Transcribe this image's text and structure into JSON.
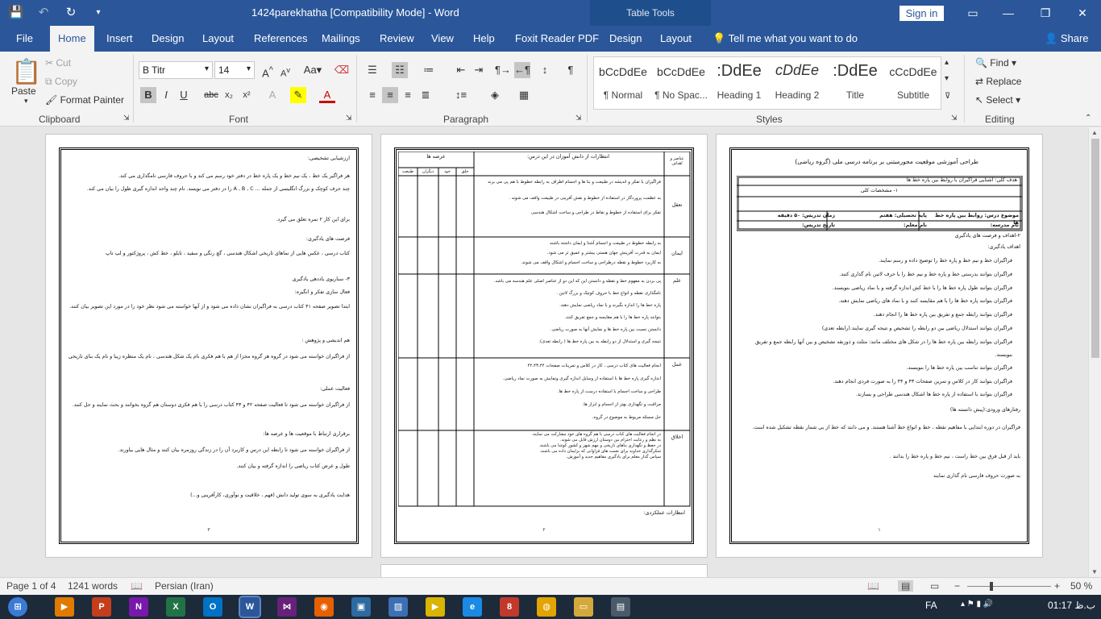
{
  "window": {
    "title": "1424parekhatha [Compatibility Mode]  -  Word",
    "context_tab": "Table Tools",
    "signin": "Sign in",
    "controls": {
      "minimize": "—",
      "restore": "❐",
      "close": "✕"
    }
  },
  "tabs": [
    "File",
    "Home",
    "Insert",
    "Design",
    "Layout",
    "References",
    "Mailings",
    "Review",
    "View",
    "Help",
    "Foxit Reader PDF",
    "Design",
    "Layout"
  ],
  "active_tab": "Home",
  "tellme": "Tell me what you want to do",
  "share": "Share",
  "ribbon": {
    "clipboard": {
      "label": "Clipboard",
      "paste": "Paste",
      "cut": "Cut",
      "copy": "Copy",
      "format_painter": "Format Painter"
    },
    "font": {
      "label": "Font",
      "name": "B Titr",
      "size": "14"
    },
    "paragraph": {
      "label": "Paragraph"
    },
    "styles": {
      "label": "Styles",
      "items": [
        {
          "preview": "bCcDdEe",
          "name": "¶ Normal"
        },
        {
          "preview": "bCcDdEe",
          "name": "¶ No Spac..."
        },
        {
          "preview": ":DdEe",
          "name": "Heading 1"
        },
        {
          "preview": "cDdEe",
          "name": "Heading 2"
        },
        {
          "preview": ":DdEe",
          "name": "Title"
        },
        {
          "preview": "cCcDdEe",
          "name": "Subtitle"
        }
      ]
    },
    "editing": {
      "label": "Editing",
      "find": "Find",
      "replace": "Replace",
      "select": "Select"
    }
  },
  "pages": {
    "page1": {
      "title": "طراحی آموزشی موقعیت محورمبتنی بر برنامه درسی ملی (گروه ریاضی)",
      "goal": "هدف کلی: آشنایی فراگیران با روابط بین پاره خط ها",
      "section1": "۱- مشخصات کلی",
      "topic": "موضوع درس: روابط بین پاره خط ها",
      "grade": "پایه تحصیلی: هفتم",
      "time": "زمان تدریس: ۵۰ دقیقه",
      "school": "نام مدرسه:",
      "teacher": "نام معلم:",
      "date": "تاریخ تدریس:",
      "goals_heading": "۲-اهداف و فرصت های یادگیری",
      "learning_goals": "اهداف یادگیری:",
      "bullets": [
        "فراگیران خط و نیم خط و پاره خط را توضیح داده و رسم نمایند.",
        "فراگیران بتوانند بدرستی خط و پاره خط و نیم خط را با حرف لاتین نام گذاری کنند.",
        "فراگیران بتوانند طول پاره خط ها را با خط کش اندازه گرفته و با نماد ریاضی بنویسند.",
        "فراگیران بتوانند پاره خط ها را با هم مقایسه کنند و با نماد های ریاضی نمایش دهند.",
        "فراگیران بتوانند رابطه جمع و تفریق بین پاره خط ها را انجام دهند.",
        "فراگیران بتوانند استدلال ریاضی بین دو رابطه را تشخیص و نتیجه گیری نمایند.(رابطه تعدی)",
        "فراگیران بتوانند رابطه بین پاره خط ها را در شکل های مختلف مانند: مثلث و ذوزنقه تشخیص و بین آنها رابطه جمع و تفریق بنویسند.",
        "فراگیران بتوانند تناسب بین پاره خط ها را بنویسند.",
        "فراگیران بتوانند کار در کلاس و تمرین صفحات ۴۳ و ۴۴ را به صورت فردی انجام دهند.",
        "فراگیران بتوانند با استفاده از پاره خط ها اشکال هندسی طراحی و بسازند."
      ],
      "entry": "رفتارهای ورودی:(پیش دانسته ها)",
      "entry_text": "فراگیران در دوره ابتدایی با مفاهیم نقطه ، خط و انواع خط آشنا هستند. و می دانند که خط از بی شمار نقطه تشکیل شده است.",
      "entry_text2": "باید از قبل فرق بین خط راست ، نیم خط و پاره خط را بدانند .",
      "entry_text3": "به صورت حروف فارسی نام گذاری نمایند",
      "page_number": "۱"
    },
    "page2": {
      "col_areas": "عرصه ها",
      "col_expectations": "انتظارات از دانش آموزان در این درس:",
      "col_elements": "عناصر و اهداف",
      "sub_cols": [
        "خلق",
        "خود",
        "دیگران",
        "طبیعت"
      ],
      "rows": [
        {
          "label": "تعقل",
          "lines": [
            "فراگیران با تفکر و اندیشه در طبیعت و بنا ها و اجسام اطراف به رابطه خطوط با هم پی می برند",
            "به عظمت پروردگار در استفاده از خطوط و نقش آفرینی در طبیعت واقف می شوند .",
            "تفکر برای استفاده از خطوط و نقاط در طراحی و ساخت اشکال هندسی"
          ]
        },
        {
          "label": "ایمان",
          "lines": [
            "به رابطه خطوط در طبیعت و اجسام آشنا و ایمان داشته باشند",
            "ایمان به قدرت آفرینش جهان هستی بیشتر و عمیق تر می شود.",
            "به کاربرد خطوط و نقطه درطراحی و ساخت اجسام و اشکال واقف می شوند."
          ]
        },
        {
          "label": "علم",
          "lines": [
            "پی بردن به مفهوم خط و نقطه و دانستن این که این دو از عناصر اصلی علم هندسه می باشد.",
            "نامگذاری نقطه و انواع خط با حروف کوچک و بزرگ لاتین .",
            "پاره خط ها را اندازه بگیرند و با نماد ریاضی نمایش دهند.",
            "بتوانند پاره خط ها را با هم مقایسه و جمع تفریق کنند.",
            "دانستن نسبت بین پاره خط ها و نمایش آنها به صورت ریاضی.",
            "نتیجه گیری و استدلال از دو رابطه به بین پاره خط ها ( رابطه تعدی)."
          ]
        },
        {
          "label": "عمل",
          "lines": [
            "انجام فعالیت های کتاب درسی ، کار در کلاس و تمرینات صفحات ۴۲،۴۳،۴۴",
            "اندازه گیری پاره خط ها با استفاده از وسایل اندازه گیری وتمایش به صورت نماد ریاضی.",
            "طراحی و ساخت اجسام با استفاده درست از پاره خط ها.",
            "مراقبت و نگهداری بهتر از اجسام و ابزار ها.",
            "حل مسئله مربوط به موضوع در گروه."
          ]
        },
        {
          "label": "اخلاق",
          "lines": [
            "در انجام فعالیت های کتاب درسی با هم گروه های خود مشارکت می نمایند.",
            "به نظم و رعایت احترام بین دوستان ارزش قایل می شوند.",
            "در حفظ و نگهداری بناهای تاریخی و مهم شهر و کشور کوشا می باشند.",
            "شکرگذاری خداوند برای نعمت های فراوانی که برایمان داده می باشند.",
            "سپاس گذار معلم برای یادگیری مفاهیم جدید و آموزش."
          ]
        }
      ],
      "footer": "انتظارات عملکردی:",
      "page_number": "۲"
    },
    "page3": {
      "assessment": "ارزشیابی تشخیصی:",
      "assessment_text": "هر فراگیر یک خط ، یک نیم خط و یک پاره خط در دفتر خود رسم می کند و با حروف فارسی نامگذاری می کند.",
      "assessment_text2": "چند حرف کوچک و بزرگ انگلیسی از جمله ... A , B , C را در دفتر می نویسد. نام چند واحد اندازه گیری طول را بیان می کند.",
      "score": "برای این کار ۲ نمره تعلق می گیرد.",
      "opportunities": "فرصت های یادگیری:",
      "opportunities_text": "کتاب درسی ، عکس هایی از نماهای تاریخی اشکال هندسی ، گچ رنگی و سفید ، تابلو ، خط کش ، پروژکتور و لپ تاپ",
      "scenario": "۳- سناریوی یاددهی یادگیری",
      "activation": "فعال سازی تفکر و انگیزه:",
      "activation_text": "ابتدا تصویر صفحه ۴۱ کتاب درسی به فراگیران نشان داده می شود و از آنها خواسته می شود نظر خود را در مورد این تصویر بیان کنند. همچنین عکس هایی از بناهای تاریخی جاهای مختلف در پروژکتور به فراگیران نشان داده می شود.",
      "research": "هم اندیشی و پژوهش :",
      "research_text": "از فراگیران خواسته می شود در گروه هر گروه مجزا از هم با هم فکری نام یک شکل هندسی ، نام یک منظره زیبا و نام یک بنای تاریخی را بیان نمایند. در رابطه با ابعاد و اجزای تشکیل دهنده اجسام و اشکال بحث و نتیجه را بیان کنند.",
      "practice": "فعالیت عملی:",
      "practice_text": "از فراگیران خواسته می شود تا فعالیت صفحه ۴۲ و ۴۳ کتاب درسی را با هم فکری دوستان هم گروه بخوانند و بحث نمایند و حل کنند.",
      "link": "برقراری ارتباط با موقعیت ها و عرصه ها:",
      "link_text": "از فراگیران خواسته می شود تا رابطه این درس و کاربرد آن را در زندگی روزمره بیان کنند و مثال هایی بیاورند.",
      "link_text2": "طول و عرض کتاب ریاضی را اندازه گرفته و بیان کنند.",
      "guide": "هدایت یادگیری به سوی تولید دانش (فهم ، خلاقیت و نوآوری، کارآفرینی و...)",
      "page_number": "۳"
    }
  },
  "status": {
    "page": "Page 1 of 4",
    "words": "1241 words",
    "language": "Persian (Iran)",
    "zoom": "50 %"
  },
  "taskbar": {
    "lang": "FA",
    "time": "01:17",
    "ampm": "ب.ظ"
  }
}
